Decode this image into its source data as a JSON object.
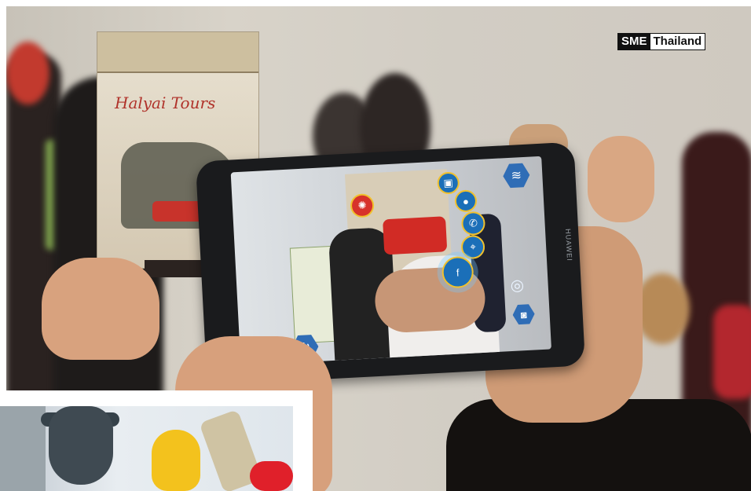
{
  "watermark": {
    "part1": "SME",
    "part2": "Thailand"
  },
  "box": {
    "title": "Halyai Tours"
  },
  "phone": {
    "brand": "HUAWEI"
  },
  "ar_buttons": [
    "bus-icon",
    "person-icon",
    "phone-icon",
    "location-icon",
    "facebook-icon"
  ],
  "ar_controls": [
    "layers-icon",
    "camera-switch-icon",
    "camera-icon",
    "lock-icon",
    "refresh-icon"
  ]
}
